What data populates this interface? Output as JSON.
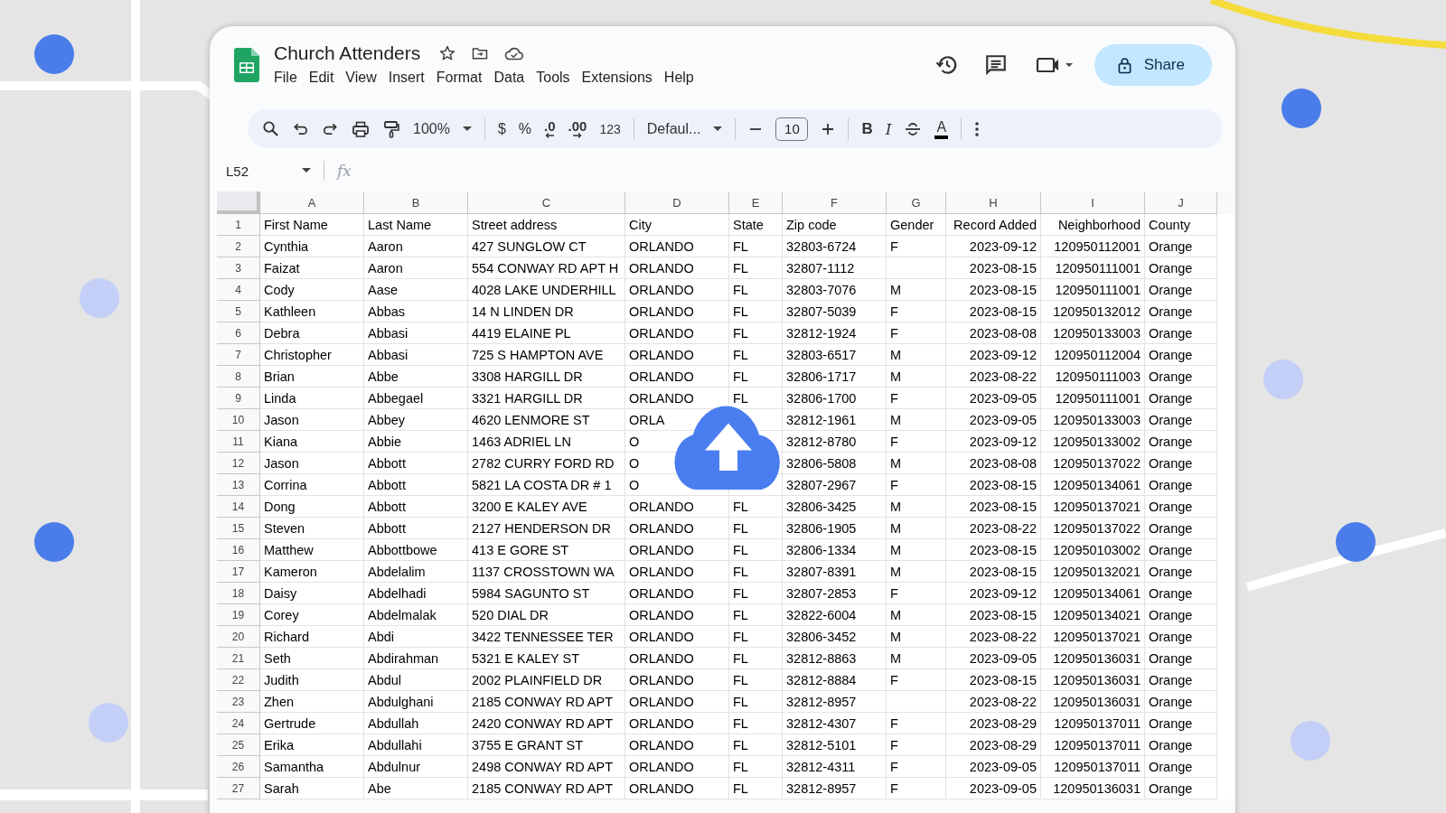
{
  "document": {
    "title": "Church Attenders"
  },
  "menu": [
    "File",
    "Edit",
    "View",
    "Insert",
    "Format",
    "Data",
    "Tools",
    "Extensions",
    "Help"
  ],
  "share_button": "Share",
  "toolbar": {
    "zoom": "100%",
    "currency": "$",
    "percent": "%",
    "decrease_decimals": ".0",
    "increase_decimals": ".00",
    "number_format": "123",
    "font": "Defaul...",
    "font_size": "10",
    "bold": "B",
    "italic": "I",
    "text_color": "A"
  },
  "name_box": "L52",
  "formula_label": "fx",
  "columns": [
    "A",
    "B",
    "C",
    "D",
    "E",
    "F",
    "G",
    "H",
    "I",
    "J"
  ],
  "rows": [
    {
      "number": "1",
      "cells": [
        "First Name",
        "Last Name",
        "Street address",
        "City",
        "State",
        "Zip code",
        "Gender",
        "Record Added",
        "Neighborhood",
        "County"
      ]
    },
    {
      "number": "2",
      "cells": [
        "Cynthia",
        "Aaron",
        "427 SUNGLOW CT",
        "ORLANDO",
        "FL",
        "32803-6724",
        "F",
        "2023-09-12",
        "120950112001",
        "Orange"
      ]
    },
    {
      "number": "3",
      "cells": [
        "Faizat",
        "Aaron",
        "554 CONWAY RD APT H",
        "ORLANDO",
        "FL",
        "32807-1112",
        null,
        "2023-08-15",
        "120950111001",
        "Orange"
      ]
    },
    {
      "number": "4",
      "cells": [
        "Cody",
        "Aase",
        "4028 LAKE UNDERHILL",
        "ORLANDO",
        "FL",
        "32803-7076",
        "M",
        "2023-08-15",
        "120950111001",
        "Orange"
      ]
    },
    {
      "number": "5",
      "cells": [
        "Kathleen",
        "Abbas",
        "14 N LINDEN DR",
        "ORLANDO",
        "FL",
        "32807-5039",
        "F",
        "2023-08-15",
        "120950132012",
        "Orange"
      ]
    },
    {
      "number": "6",
      "cells": [
        "Debra",
        "Abbasi",
        "4419 ELAINE PL",
        "ORLANDO",
        "FL",
        "32812-1924",
        "F",
        "2023-08-08",
        "120950133003",
        "Orange"
      ]
    },
    {
      "number": "7",
      "cells": [
        "Christopher",
        "Abbasi",
        "725 S HAMPTON AVE",
        "ORLANDO",
        "FL",
        "32803-6517",
        "M",
        "2023-09-12",
        "120950112004",
        "Orange"
      ]
    },
    {
      "number": "8",
      "cells": [
        "Brian",
        "Abbe",
        "3308 HARGILL DR",
        "ORLANDO",
        "FL",
        "32806-1717",
        "M",
        "2023-08-22",
        "120950111003",
        "Orange"
      ]
    },
    {
      "number": "9",
      "cells": [
        "Linda",
        "Abbegael",
        "3321 HARGILL DR",
        "ORLANDO",
        "FL",
        "32806-1700",
        "F",
        "2023-09-05",
        "120950111001",
        "Orange"
      ]
    },
    {
      "number": "10",
      "cells": [
        "Jason",
        "Abbey",
        "4620 LENMORE ST",
        "ORLA",
        null,
        "32812-1961",
        "M",
        "2023-09-05",
        "120950133003",
        "Orange"
      ]
    },
    {
      "number": "11",
      "cells": [
        "Kiana",
        "Abbie",
        "1463 ADRIEL LN",
        "O",
        null,
        "32812-8780",
        "F",
        "2023-09-12",
        "120950133002",
        "Orange"
      ]
    },
    {
      "number": "12",
      "cells": [
        "Jason",
        "Abbott",
        "2782 CURRY FORD RD",
        "O",
        null,
        "32806-5808",
        "M",
        "2023-08-08",
        "120950137022",
        "Orange"
      ]
    },
    {
      "number": "13",
      "cells": [
        "Corrina",
        "Abbott",
        "5821 LA COSTA DR # 1",
        "O",
        null,
        "32807-2967",
        "F",
        "2023-08-15",
        "120950134061",
        "Orange"
      ]
    },
    {
      "number": "14",
      "cells": [
        "Dong",
        "Abbott",
        "3200 E KALEY AVE",
        "ORLANDO",
        "FL",
        "32806-3425",
        "M",
        "2023-08-15",
        "120950137021",
        "Orange"
      ]
    },
    {
      "number": "15",
      "cells": [
        "Steven",
        "Abbott",
        "2127 HENDERSON DR",
        "ORLANDO",
        "FL",
        "32806-1905",
        "M",
        "2023-08-22",
        "120950137022",
        "Orange"
      ]
    },
    {
      "number": "16",
      "cells": [
        "Matthew",
        "Abbottbowe",
        "413 E GORE ST",
        "ORLANDO",
        "FL",
        "32806-1334",
        "M",
        "2023-08-15",
        "120950103002",
        "Orange"
      ]
    },
    {
      "number": "17",
      "cells": [
        "Kameron",
        "Abdelalim",
        "1137 CROSSTOWN WA",
        "ORLANDO",
        "FL",
        "32807-8391",
        "M",
        "2023-08-15",
        "120950132021",
        "Orange"
      ]
    },
    {
      "number": "18",
      "cells": [
        "Daisy",
        "Abdelhadi",
        "5984 SAGUNTO ST",
        "ORLANDO",
        "FL",
        "32807-2853",
        "F",
        "2023-09-12",
        "120950134061",
        "Orange"
      ]
    },
    {
      "number": "19",
      "cells": [
        "Corey",
        "Abdelmalak",
        "520 DIAL DR",
        "ORLANDO",
        "FL",
        "32822-6004",
        "M",
        "2023-08-15",
        "120950134021",
        "Orange"
      ]
    },
    {
      "number": "20",
      "cells": [
        "Richard",
        "Abdi",
        "3422 TENNESSEE TER",
        "ORLANDO",
        "FL",
        "32806-3452",
        "M",
        "2023-08-22",
        "120950137021",
        "Orange"
      ]
    },
    {
      "number": "21",
      "cells": [
        "Seth",
        "Abdirahman",
        "5321 E KALEY ST",
        "ORLANDO",
        "FL",
        "32812-8863",
        "M",
        "2023-09-05",
        "120950136031",
        "Orange"
      ]
    },
    {
      "number": "22",
      "cells": [
        "Judith",
        "Abdul",
        "2002 PLAINFIELD DR",
        "ORLANDO",
        "FL",
        "32812-8884",
        "F",
        "2023-08-15",
        "120950136031",
        "Orange"
      ]
    },
    {
      "number": "23",
      "cells": [
        "Zhen",
        "Abdulghani",
        "2185 CONWAY RD APT",
        "ORLANDO",
        "FL",
        "32812-8957",
        null,
        "2023-08-22",
        "120950136031",
        "Orange"
      ]
    },
    {
      "number": "24",
      "cells": [
        "Gertrude",
        "Abdullah",
        "2420 CONWAY RD APT",
        "ORLANDO",
        "FL",
        "32812-4307",
        "F",
        "2023-08-29",
        "120950137011",
        "Orange"
      ]
    },
    {
      "number": "25",
      "cells": [
        "Erika",
        "Abdullahi",
        "3755 E GRANT ST",
        "ORLANDO",
        "FL",
        "32812-5101",
        "F",
        "2023-08-29",
        "120950137011",
        "Orange"
      ]
    },
    {
      "number": "26",
      "cells": [
        "Samantha",
        "Abdulnur",
        "2498 CONWAY RD APT",
        "ORLANDO",
        "FL",
        "32812-4311",
        "F",
        "2023-09-05",
        "120950137011",
        "Orange"
      ]
    },
    {
      "number": "27",
      "cells": [
        "Sarah",
        "Abe",
        "2185 CONWAY RD APT",
        "ORLANDO",
        "FL",
        "32812-8957",
        "F",
        "2023-09-05",
        "120950136031",
        "Orange"
      ]
    }
  ]
}
